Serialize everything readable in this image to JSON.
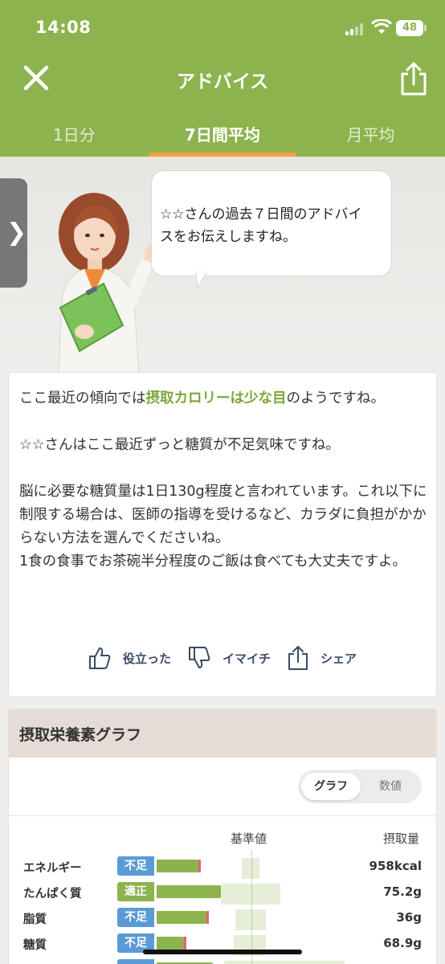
{
  "status_bar": {
    "time": "14:08",
    "battery": "48"
  },
  "header": {
    "title": "アドバイス"
  },
  "tabs": [
    {
      "label": "1日分",
      "active": false
    },
    {
      "label": "7日間平均",
      "active": true
    },
    {
      "label": "月平均",
      "active": false
    }
  ],
  "advisor": {
    "bubble_line1": "☆☆さんの過去７日間のアドバイ",
    "bubble_line2": "スをお伝えしますね。"
  },
  "advice": {
    "p1_prefix": "ここ最近の傾向では",
    "p1_highlight": "摂取カロリーは少な目",
    "p1_suffix": "のようですね。",
    "p2": "☆☆さんはここ最近ずっと糖質が不足気味ですね。",
    "p3": "脳に必要な糖質量は1日130g程度と言われています。これ以下に制限する場合は、医師の指導を受けるなど、カラダに負担がかからない方法を選んでくださいね。",
    "p4": "1食の食事でお茶碗半分程度のご飯は食べても大丈夫ですよ。",
    "like_label": "役立った",
    "dislike_label": "イマイチ",
    "share_label": "シェア"
  },
  "graph": {
    "title": "摂取栄養素グラフ",
    "toggle_graph": "グラフ",
    "toggle_values": "数値",
    "col_reference": "基準値",
    "col_intake": "摂取量",
    "rows": [
      {
        "name": "エネルギー",
        "status": "不足",
        "value": "958kcal"
      },
      {
        "name": "たんぱく質",
        "status": "適正",
        "value": "75.2g"
      },
      {
        "name": "脂質",
        "status": "不足",
        "value": "36g"
      },
      {
        "name": "糖質",
        "status": "不足",
        "value": "68.9g"
      }
    ]
  },
  "colors": {
    "brand_green": "#8db34e",
    "tab_underline": "#f2a03d",
    "deficient_badge": "#5b9bd5",
    "adequate_badge": "#8db34e"
  }
}
